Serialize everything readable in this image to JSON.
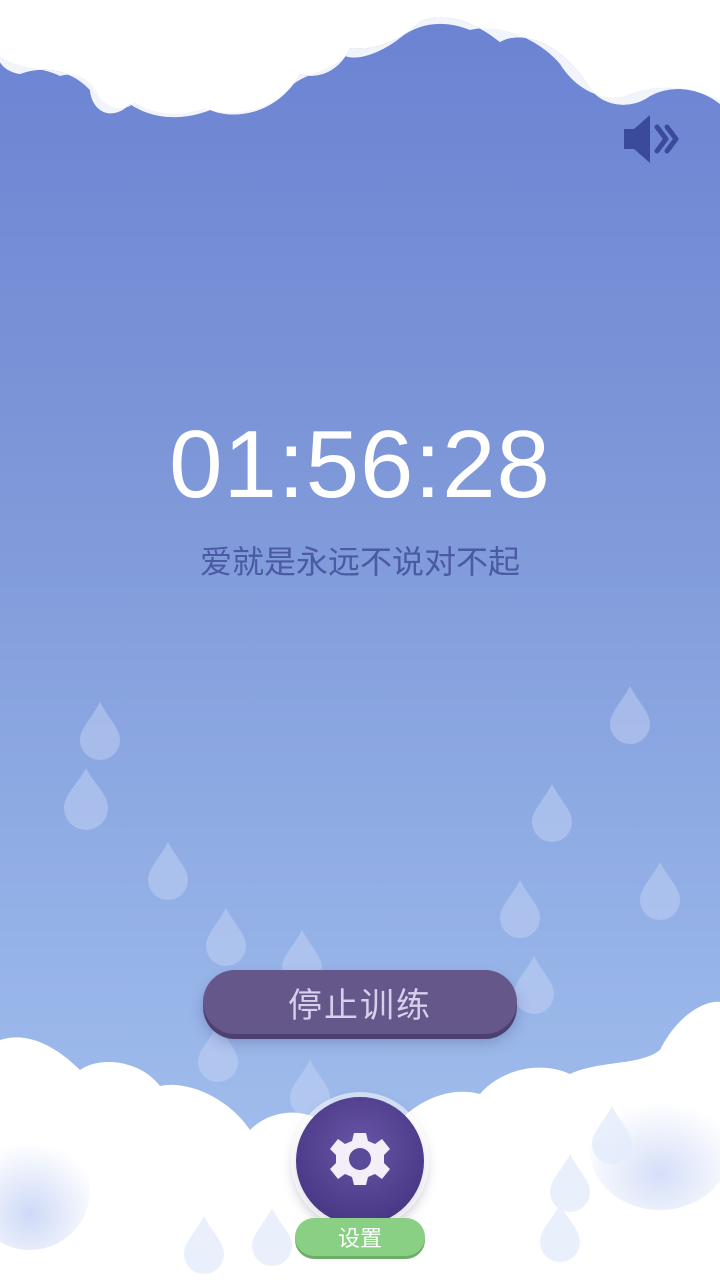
{
  "timer": {
    "display": "01:56:28"
  },
  "quote": {
    "text": "爱就是永远不说对不起"
  },
  "controls": {
    "stop_label": "停止训练",
    "settings_label": "设置",
    "sound_icon": "speaker-volume-icon",
    "settings_icon": "gear-icon"
  },
  "colors": {
    "sky_top": "#6b82d2",
    "sky_bottom": "#a8c3ef",
    "quote_text": "#4a5aa4",
    "stop_button": "#65578a",
    "settings_circle": "#4a3a88",
    "settings_label_bg": "#89cf84",
    "sound_icon": "#3b4a9a"
  }
}
